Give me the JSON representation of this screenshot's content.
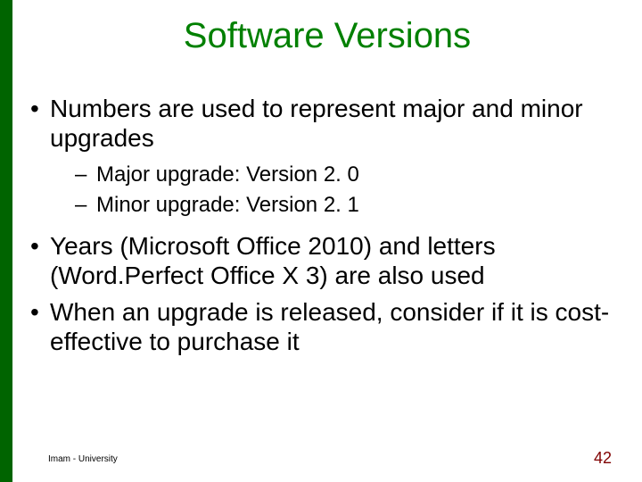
{
  "title": "Software Versions",
  "bullets": {
    "b1": "Numbers are used to represent major and minor upgrades",
    "s1": "Major upgrade: Version 2. 0",
    "s2": "Minor upgrade: Version 2. 1",
    "b2": "Years (Microsoft Office 2010) and letters (Word.Perfect Office X 3) are also used",
    "b3": "When an upgrade is released, consider if it is cost-effective to purchase it"
  },
  "footer": {
    "left": "Imam - University",
    "page": "42"
  }
}
